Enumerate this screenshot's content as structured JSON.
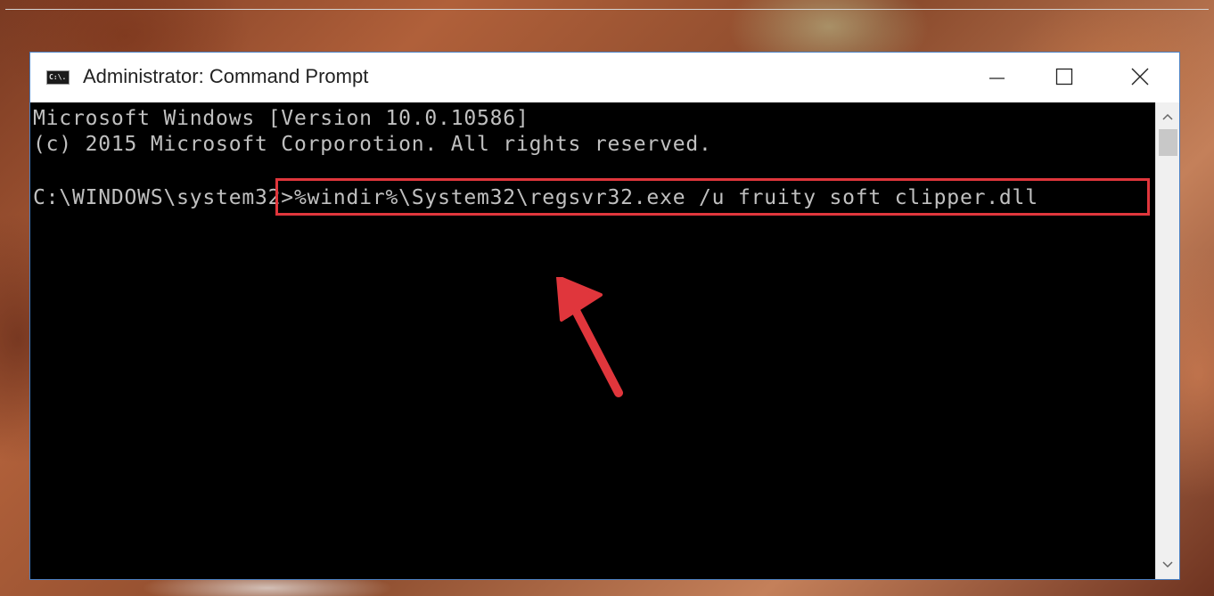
{
  "window": {
    "title": "Administrator: Command Prompt",
    "icon_label": "C:\\."
  },
  "console": {
    "lines": [
      "Microsoft Windows [Version 10.0.10586]",
      "(c) 2015 Microsoft Corporotion. All rights reserved."
    ],
    "prompt": "C:\\WINDOWS\\system32>",
    "command": "%windir%\\System32\\regsvr32.exe /u fruity soft clipper.dll"
  },
  "annotation": {
    "highlight_color": "#e0363c",
    "arrow_color": "#e0363c"
  },
  "icons": {
    "minimize": "minimize-icon",
    "maximize": "maximize-icon",
    "close": "close-icon",
    "scroll_up": "chevron-up-icon",
    "scroll_down": "chevron-down-icon"
  }
}
